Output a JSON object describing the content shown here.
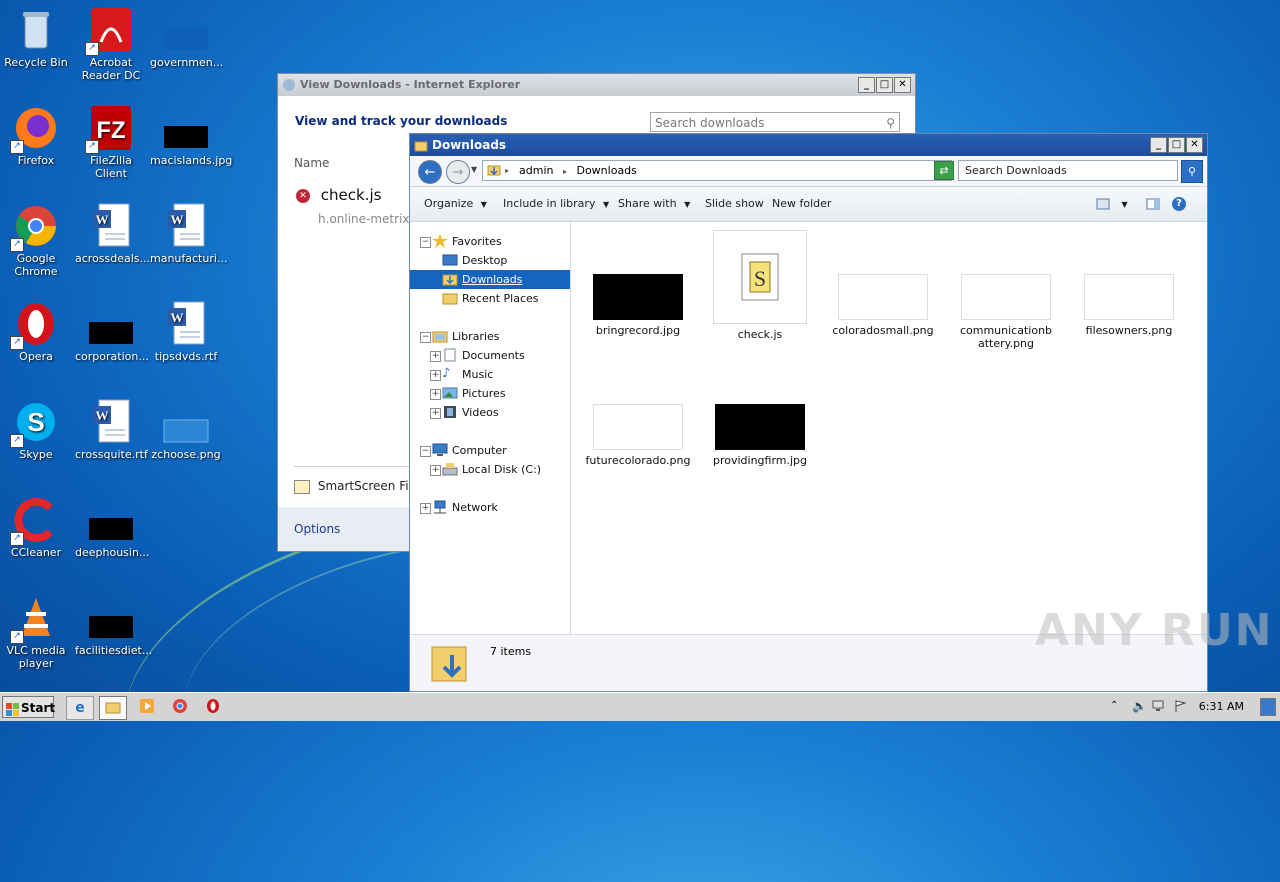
{
  "desktop": {
    "icons": [
      {
        "label": "Recycle Bin"
      },
      {
        "label": "Acrobat Reader DC"
      },
      {
        "label": "governmen..."
      },
      {
        "label": "Firefox"
      },
      {
        "label": "FileZilla Client"
      },
      {
        "label": "macislands.jpg"
      },
      {
        "label": "Google Chrome"
      },
      {
        "label": "acrossdeals..."
      },
      {
        "label": "manufacturi..."
      },
      {
        "label": "Opera"
      },
      {
        "label": "corporation..."
      },
      {
        "label": "tipsdvds.rtf"
      },
      {
        "label": "Skype"
      },
      {
        "label": "crossquite.rtf"
      },
      {
        "label": "zchoose.png"
      },
      {
        "label": "CCleaner"
      },
      {
        "label": "deephousin..."
      },
      {
        "label": "VLC media player"
      },
      {
        "label": "facilitiesdiet..."
      }
    ]
  },
  "ie_window": {
    "title": "View Downloads - Internet Explorer",
    "header": "View and track your downloads",
    "search_placeholder": "Search downloads",
    "column_name": "Name",
    "item_name": "check.js",
    "item_source": "h.online-metrix.n",
    "smartscreen": "SmartScreen Filte",
    "options": "Options"
  },
  "explorer": {
    "title": "Downloads",
    "breadcrumb": [
      "admin",
      "Downloads"
    ],
    "search_placeholder": "Search Downloads",
    "toolbar": {
      "organize": "Organize",
      "include": "Include in library",
      "share": "Share with",
      "slideshow": "Slide show",
      "newfolder": "New folder"
    },
    "nav": {
      "favorites": "Favorites",
      "desktop": "Desktop",
      "downloads": "Downloads",
      "recent": "Recent Places",
      "libraries": "Libraries",
      "documents": "Documents",
      "music": "Music",
      "pictures": "Pictures",
      "videos": "Videos",
      "computer": "Computer",
      "localdisk": "Local Disk (C:)",
      "network": "Network"
    },
    "files": [
      {
        "name": "bringrecord.jpg",
        "thumb": "black"
      },
      {
        "name": "check.js",
        "thumb": "script"
      },
      {
        "name": "coloradosmall.png",
        "thumb": "white"
      },
      {
        "name": "communicationbattery.png",
        "thumb": "white"
      },
      {
        "name": "filesowners.png",
        "thumb": "white"
      },
      {
        "name": "futurecolorado.png",
        "thumb": "white"
      },
      {
        "name": "providingfirm.jpg",
        "thumb": "black"
      }
    ],
    "item_count": "7 items"
  },
  "taskbar": {
    "start": "Start",
    "clock": "6:31 AM"
  },
  "watermark": "ANY RUN"
}
